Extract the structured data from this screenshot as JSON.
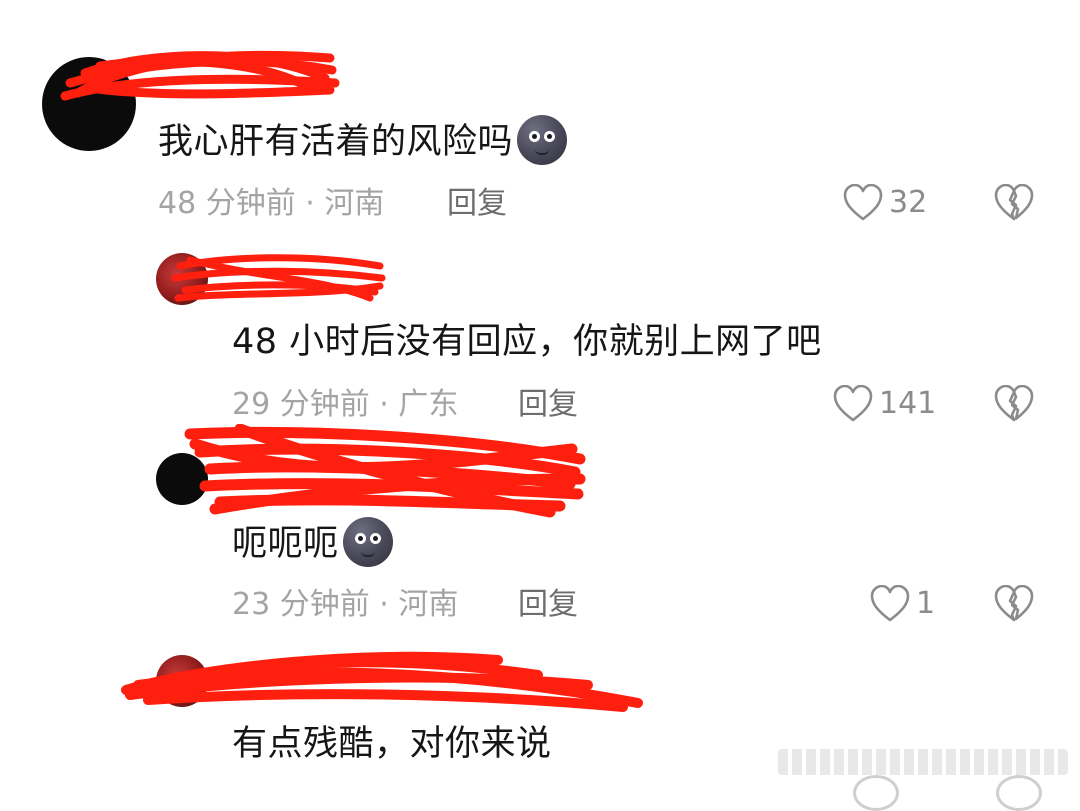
{
  "colors": {
    "scribble": "#ff1f0f",
    "meta": "#a4a4a4",
    "reply": "#6d6d6d",
    "icon": "#8b8b8b"
  },
  "comments": [
    {
      "text": "我心肝有活着的风险吗",
      "emoji": "new-moon-face",
      "time": "48 分钟前 · 河南",
      "reply_label": "回复",
      "likes": "32"
    },
    {
      "text": "48 小时后没有回应，你就别上网了吧",
      "time": "29 分钟前 · 广东",
      "reply_label": "回复",
      "likes": "141"
    },
    {
      "text": "呃呃呃",
      "emoji": "new-moon-face",
      "time": "23 分钟前 · 河南",
      "reply_label": "回复",
      "likes": "1"
    },
    {
      "text": "有点残酷，对你来说"
    }
  ]
}
